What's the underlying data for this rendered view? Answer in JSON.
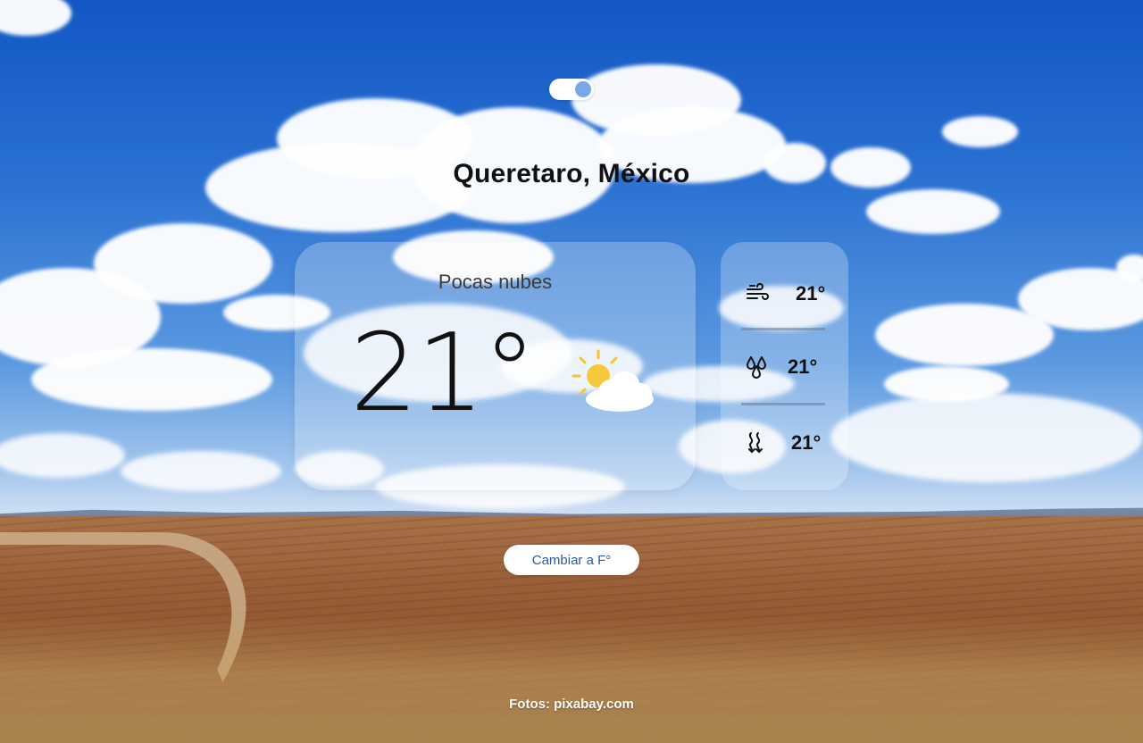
{
  "page": {
    "background_description_colors": {
      "sky": "#2a71d2",
      "field": "#9a5f38"
    }
  },
  "toggle": {
    "state": "on",
    "track_color": "#ffffff",
    "knob_color": "#7aa7e6"
  },
  "location": {
    "name": "Queretaro, México"
  },
  "current": {
    "description": "Pocas nubes",
    "temperature": "21°",
    "icon": "sun-behind-cloud-icon"
  },
  "metrics": [
    {
      "icon": "wind-icon",
      "value": "21°"
    },
    {
      "icon": "humidity-drops-icon",
      "value": "21°"
    },
    {
      "icon": "heat-waves-icon",
      "value": "21°"
    }
  ],
  "actions": {
    "unit_toggle_label": "Cambiar a F°"
  },
  "footer": {
    "credit": "Fotos: pixabay.com"
  }
}
